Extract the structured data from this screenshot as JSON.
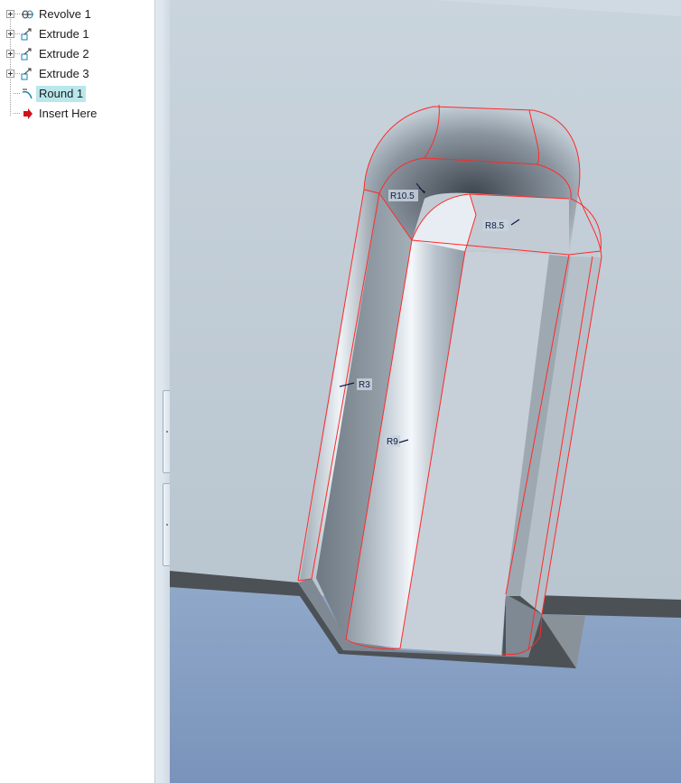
{
  "model_tree": {
    "items": [
      {
        "label": "Revolve 1",
        "icon": "revolve-icon",
        "expandable": true,
        "selected": false
      },
      {
        "label": "Extrude 1",
        "icon": "extrude-icon",
        "expandable": true,
        "selected": false
      },
      {
        "label": "Extrude 2",
        "icon": "extrude-icon",
        "expandable": true,
        "selected": false
      },
      {
        "label": "Extrude 3",
        "icon": "extrude-icon",
        "expandable": true,
        "selected": false
      },
      {
        "label": "Round 1",
        "icon": "round-icon",
        "expandable": false,
        "selected": true
      },
      {
        "label": "Insert Here",
        "icon": "insert-arrow-icon",
        "expandable": false,
        "selected": false
      }
    ]
  },
  "viewport": {
    "dimensions": {
      "r10_5": "R10.5",
      "r8_5": "R8.5",
      "r3": "R3",
      "r9": "R9"
    },
    "colors": {
      "selection_highlight": "#b9e7ec",
      "edge_highlight": "#ff2a2a",
      "background_top": "#c8d3dc",
      "background_bottom": "#7a95bc"
    }
  }
}
